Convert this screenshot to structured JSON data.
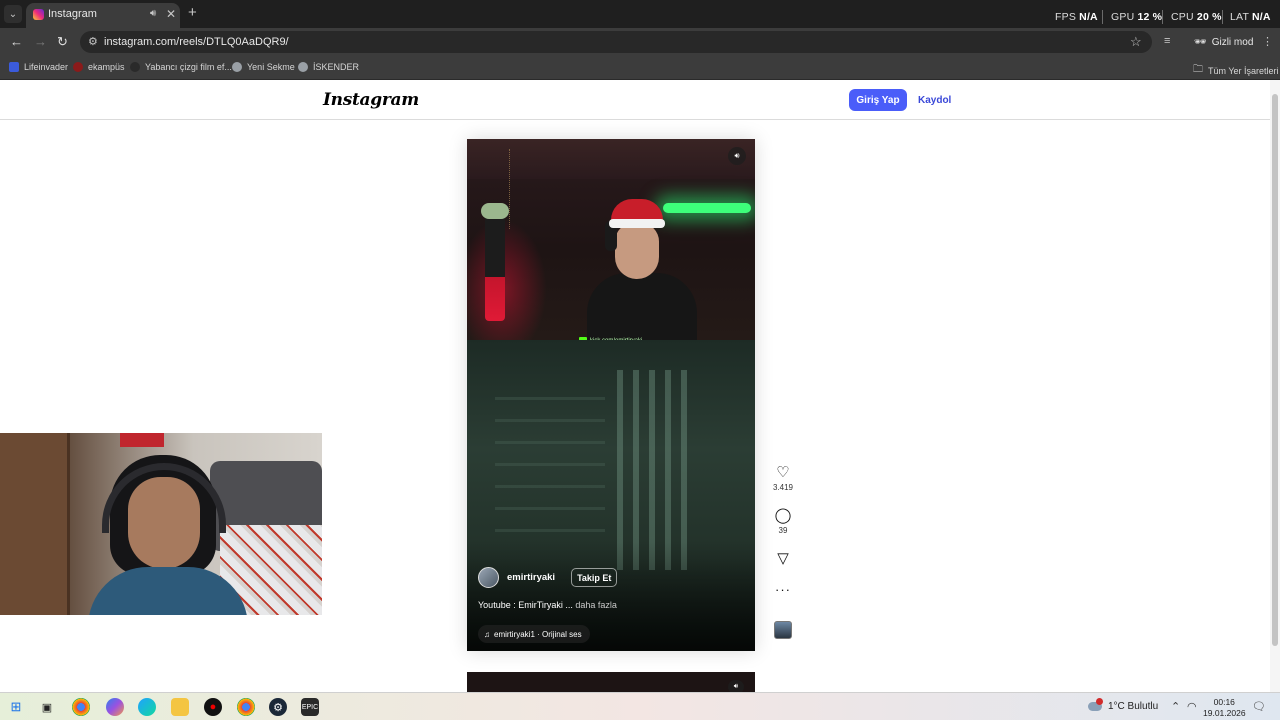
{
  "browser": {
    "tab": {
      "title": "Instagram",
      "favicon": "instagram-icon"
    },
    "url": "instagram.com/reels/DTLQ0AaDQR9/",
    "incognito_label": "Gizli mod",
    "perf": [
      {
        "label": "FPS",
        "value": "N/A"
      },
      {
        "label": "GPU",
        "value": "12 %"
      },
      {
        "label": "CPU",
        "value": "20 %"
      },
      {
        "label": "LAT",
        "value": "N/A"
      }
    ],
    "bookmarks": [
      {
        "label": "Lifeinvader",
        "color": "#3b5bdb"
      },
      {
        "label": "ekampüs",
        "color": "#8b1a1a"
      },
      {
        "label": "Yabancı çizgi film ef...",
        "color": "#2a2a2a"
      },
      {
        "label": "Yeni Sekme",
        "color": "#9aa0a6"
      },
      {
        "label": "İSKENDER",
        "color": "#9aa0a6"
      }
    ],
    "all_bookmarks_label": "Tüm Yer İşaretleri"
  },
  "instagram": {
    "logo": "Instagram",
    "login_label": "Giriş Yap",
    "signup_label": "Kaydol",
    "accent_color": "#4a5df9",
    "reel": {
      "watermark": "kick.com/emirtiryaki",
      "author": "emirtiryaki",
      "follow_label": "Takip Et",
      "caption": "Youtube : EmirTiryaki ...",
      "caption_more": "daha fazla",
      "audio": "emirtiryaki1 · Orijinal ses",
      "likes": "3.419",
      "comments": "39"
    }
  },
  "taskbar": {
    "weather": "1°C  Bulutlu",
    "time": "00:16",
    "date": "19.01.2026"
  }
}
